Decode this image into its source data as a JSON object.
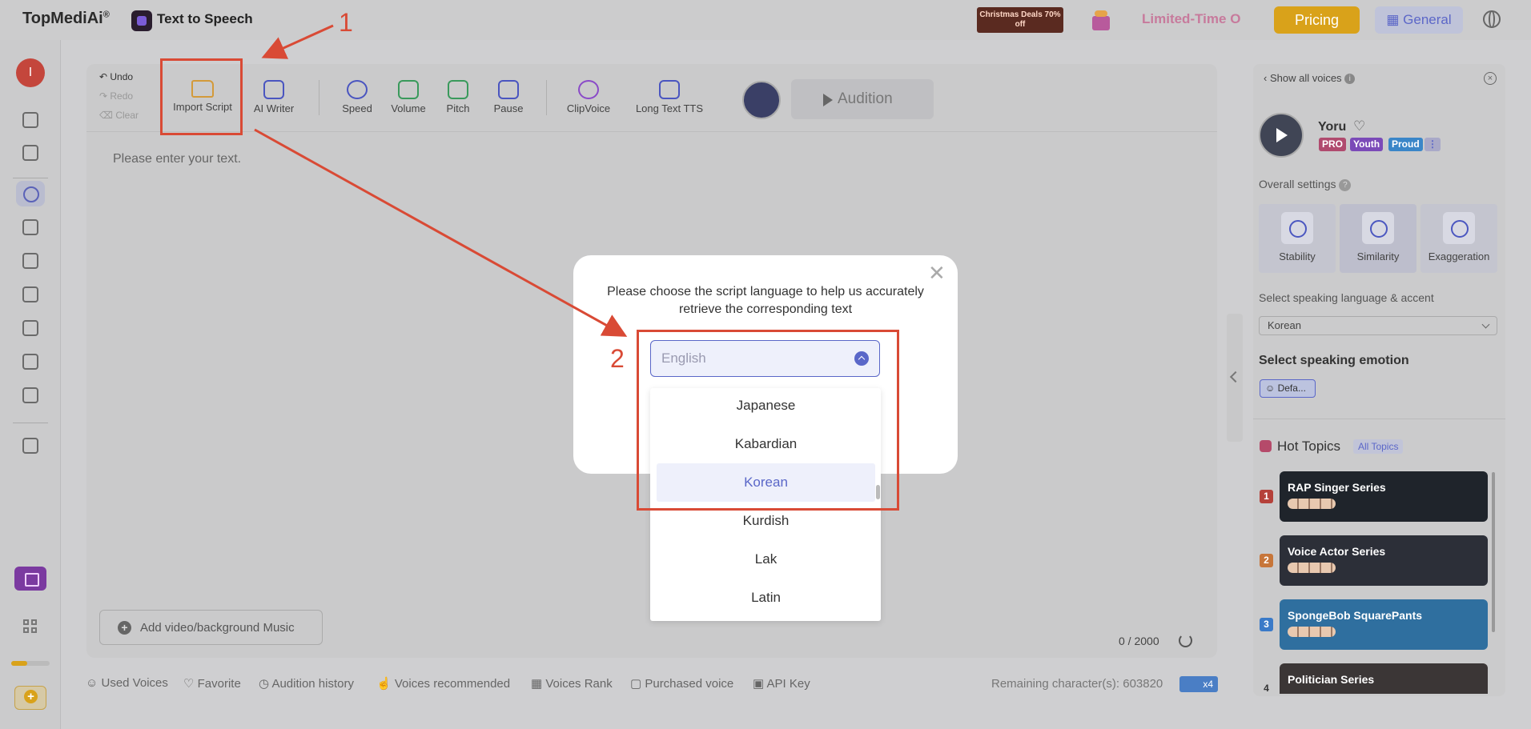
{
  "topbar": {
    "logo_text": "TopMediAi",
    "logo_mark": "®",
    "app_name": "Text to Speech",
    "promo_badge": "Christmas Deals 70% off",
    "limited_text": "Limited-Time O",
    "pricing_label": "Pricing",
    "general_label": "General"
  },
  "sidebar": {
    "user_initial": "I"
  },
  "toolbar": {
    "undo": "Undo",
    "redo": "Redo",
    "clear": "Clear",
    "import_script": "Import Script",
    "ai_writer": "AI Writer",
    "speed": "Speed",
    "volume": "Volume",
    "pitch": "Pitch",
    "pause": "Pause",
    "clipvoice": "ClipVoice",
    "long_text": "Long Text TTS",
    "audition": "Audition"
  },
  "editor": {
    "placeholder": "Please enter your text.",
    "add_music": "Add video/background Music",
    "char_count": "0 / 2000"
  },
  "bottom": {
    "links": [
      "Used Voices",
      "Favorite",
      "Audition history",
      "Voices recommended",
      "Voices Rank",
      "Purchased voice",
      "API Key"
    ],
    "remaining": "Remaining character(s): 603820",
    "multiplier": "x4"
  },
  "right_panel": {
    "show_all_voices": "Show all voices",
    "voice_name": "Yoru",
    "tags": [
      {
        "label": "PRO",
        "color": "#b04a6e"
      },
      {
        "label": "Youth",
        "color": "#7b4ab8"
      },
      {
        "label": "Proud",
        "color": "#3a86c8"
      }
    ],
    "overall_settings": "Overall settings",
    "settings": [
      "Stability",
      "Similarity",
      "Exaggeration"
    ],
    "language_label": "Select speaking language & accent",
    "language_value": "Korean",
    "emotion_label": "Select speaking emotion",
    "emotion_value": "Defa...",
    "hot_topics": "Hot Topics",
    "all_topics": "All Topics",
    "topics": [
      {
        "rank": "1",
        "title": "RAP Singer Series",
        "rank_color": "#b5413a",
        "bg": "#1f242b"
      },
      {
        "rank": "2",
        "title": "Voice Actor Series",
        "rank_color": "#c7763a",
        "bg": "#2c2f38"
      },
      {
        "rank": "3",
        "title": "SpongeBob SquarePants",
        "rank_color": "#3a7ac8",
        "bg": "#2f6f9f"
      },
      {
        "rank": "4",
        "title": "Politician Series",
        "rank_color": "#cbcbcc",
        "bg": "#3b3636"
      }
    ]
  },
  "modal": {
    "title": "Please choose the script language to help us accurately retrieve the corresponding text",
    "input_value": "English",
    "options": [
      "Japanese",
      "Kabardian",
      "Korean",
      "Kurdish",
      "Lak",
      "Latin"
    ],
    "selected": "Korean"
  },
  "annotations": {
    "step1": "1",
    "step2": "2"
  }
}
